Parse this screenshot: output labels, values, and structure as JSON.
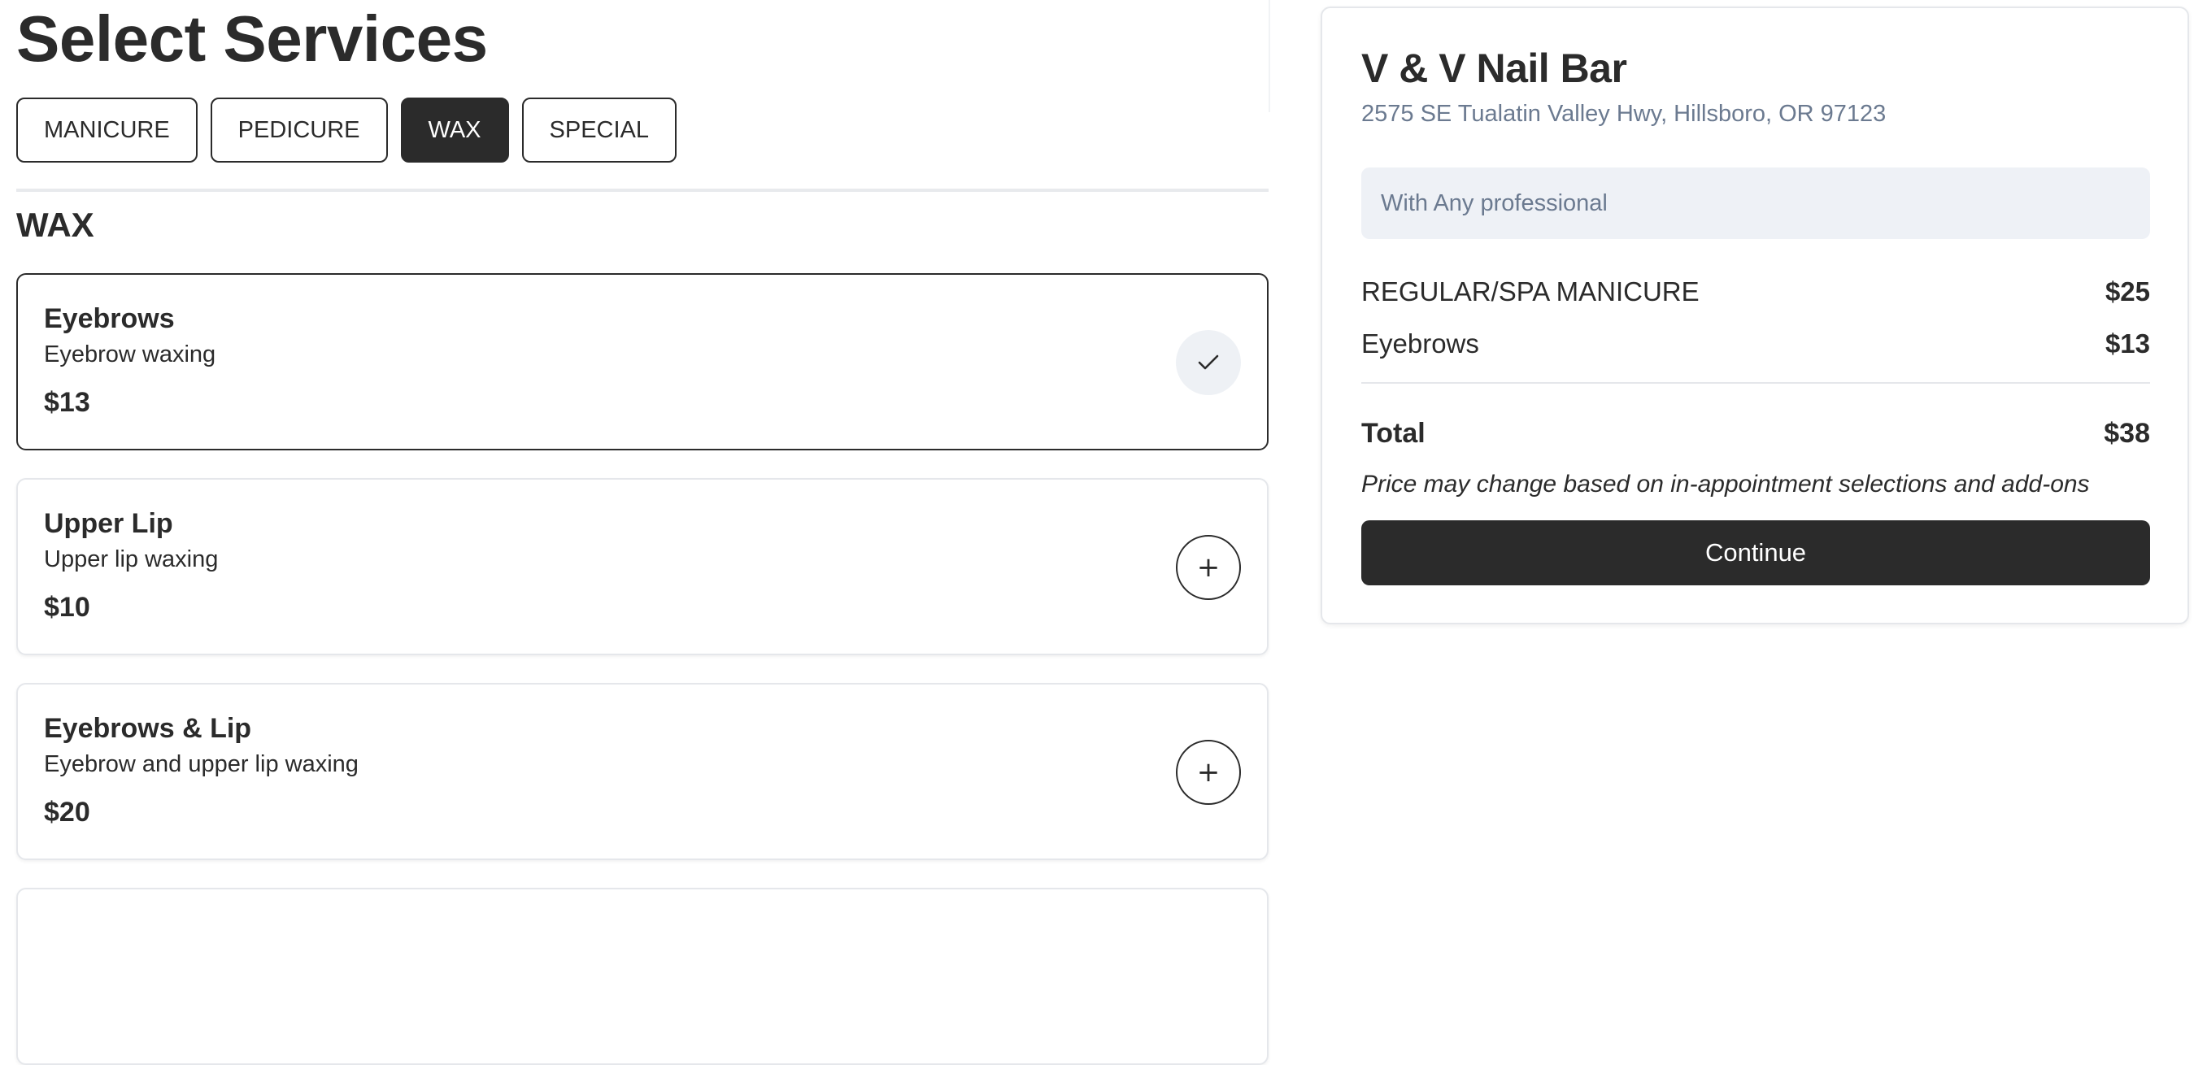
{
  "page": {
    "title": "Select Services"
  },
  "tabs": [
    {
      "label": "MANICURE",
      "active": false
    },
    {
      "label": "PEDICURE",
      "active": false
    },
    {
      "label": "WAX",
      "active": true
    },
    {
      "label": "SPECIAL",
      "active": false
    }
  ],
  "section": {
    "heading": "WAX"
  },
  "services": [
    {
      "name": "Eyebrows",
      "description": "Eyebrow waxing",
      "price": "$13",
      "selected": true,
      "action_icon": "check-icon"
    },
    {
      "name": "Upper Lip",
      "description": "Upper lip waxing",
      "price": "$10",
      "selected": false,
      "action_icon": "plus-icon",
      "action_glyph": "+"
    },
    {
      "name": "Eyebrows & Lip",
      "description": "Eyebrow and upper lip waxing",
      "price": "$20",
      "selected": false,
      "action_icon": "plus-icon",
      "action_glyph": "+"
    }
  ],
  "summary": {
    "salon_name": "V & V Nail Bar",
    "address": "2575 SE Tualatin Valley Hwy, Hillsboro, OR 97123",
    "professional": "With Any professional",
    "line_items": [
      {
        "name": "REGULAR/SPA MANICURE",
        "amount": "$25"
      },
      {
        "name": "Eyebrows",
        "amount": "$13"
      }
    ],
    "total_label": "Total",
    "total_amount": "$38",
    "disclaimer": "Price may change based on in-appointment selections and add-ons",
    "continue_label": "Continue"
  },
  "colors": {
    "primary": "#2b2b2b",
    "muted_text": "#6b7a90",
    "professional_bg": "#eef1f6",
    "card_border": "#e5e7eb",
    "check_bg": "#eef1f5"
  }
}
